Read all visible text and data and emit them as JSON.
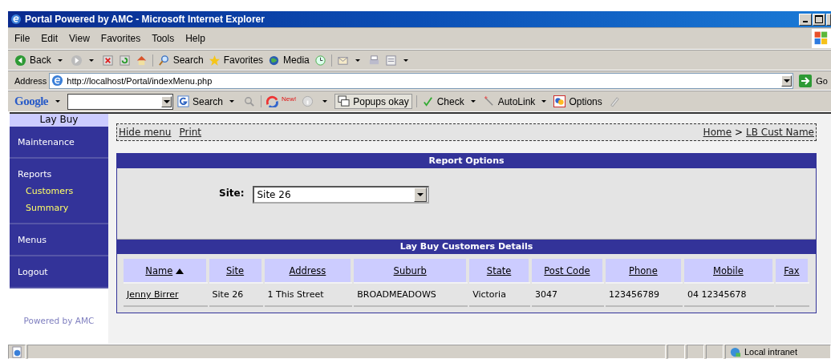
{
  "window": {
    "title": "Portal Powered by AMC - Microsoft Internet Explorer"
  },
  "menu_bar": [
    {
      "label": "File"
    },
    {
      "label": "Edit"
    },
    {
      "label": "View"
    },
    {
      "label": "Favorites"
    },
    {
      "label": "Tools"
    },
    {
      "label": "Help"
    }
  ],
  "toolbar": [
    {
      "kind": "back",
      "label": "Back"
    },
    {
      "kind": "forward"
    },
    {
      "kind": "stop"
    },
    {
      "kind": "refresh"
    },
    {
      "kind": "home"
    },
    {
      "kind": "search",
      "label": "Search"
    },
    {
      "kind": "favorites",
      "label": "Favorites"
    },
    {
      "kind": "media",
      "label": "Media"
    },
    {
      "kind": "history"
    },
    {
      "kind": "mail"
    },
    {
      "kind": "print"
    },
    {
      "kind": "edit"
    }
  ],
  "address_bar": {
    "label": "Address",
    "value": "http://localhost/Portal/indexMenu.php",
    "go": "Go"
  },
  "google_bar": {
    "logo": "Google",
    "search": "Search",
    "badge": "New!",
    "popups": "Popups okay",
    "check": "Check",
    "autolink": "AutoLink",
    "options": "Options"
  },
  "sidebar": {
    "title": "Lay Buy",
    "items": [
      {
        "label": "Maintenance"
      },
      {
        "label": "Reports",
        "children": [
          {
            "label": "Customers"
          },
          {
            "label": "Summary"
          }
        ]
      },
      {
        "label": "Menus"
      },
      {
        "label": "Logout"
      }
    ],
    "footer": "Powered by AMC"
  },
  "top_links": [
    {
      "label": "Hide menu"
    },
    {
      "label": "Print"
    }
  ],
  "breadcrumb": [
    {
      "label": "Home"
    },
    {
      "label": "LB Cust Name"
    }
  ],
  "breadcrumb_separator": ">",
  "report_options": {
    "title": "Report Options",
    "site_label": "Site:",
    "site_value": "Site 26"
  },
  "table": {
    "title": "Lay Buy Customers Details",
    "columns": [
      {
        "label": "Name",
        "sorted": true
      },
      {
        "label": "Site",
        "sorted": false
      },
      {
        "label": "Address",
        "sorted": false
      },
      {
        "label": "Suburb",
        "sorted": false
      },
      {
        "label": "State",
        "sorted": false
      },
      {
        "label": "Post Code",
        "sorted": false
      },
      {
        "label": "Phone",
        "sorted": false
      },
      {
        "label": "Mobile",
        "sorted": false
      },
      {
        "label": "Fax",
        "sorted": false
      }
    ],
    "rows": [
      [
        "Jenny Birrer",
        "Site 26",
        "1 This Street",
        "BROADMEADOWS",
        "Victoria",
        "3047",
        "123456789",
        "04 12345678",
        ""
      ]
    ]
  },
  "status_bar": {
    "zone": "Local intranet"
  }
}
